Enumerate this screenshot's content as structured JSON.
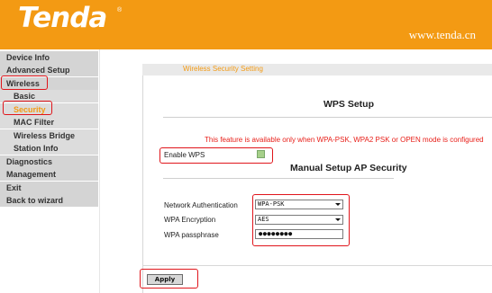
{
  "header": {
    "brand": "Tenda",
    "trademark": "®",
    "url": "www.tenda.cn",
    "background_color": "#f39a13"
  },
  "sidebar": {
    "items": [
      {
        "label": "Device Info",
        "level": "top",
        "active": false
      },
      {
        "label": "Advanced Setup",
        "level": "top",
        "active": false
      },
      {
        "label": "Wireless",
        "level": "top",
        "active": false,
        "highlighted": true
      },
      {
        "label": "Basic",
        "level": "sub",
        "active": false
      },
      {
        "label": "Security",
        "level": "sub",
        "active": true,
        "highlighted": true
      },
      {
        "label": "MAC Filter",
        "level": "sub",
        "active": false
      },
      {
        "label": "Wireless Bridge",
        "level": "sub",
        "active": false
      },
      {
        "label": "Station Info",
        "level": "sub",
        "active": false
      },
      {
        "label": "Diagnostics",
        "level": "top",
        "active": false
      },
      {
        "label": "Management",
        "level": "top",
        "active": false
      },
      {
        "label": "Exit",
        "level": "top",
        "active": false
      },
      {
        "label": "Back to wizard",
        "level": "top",
        "active": false
      }
    ],
    "active_color": "#f39a13"
  },
  "main": {
    "section_title": "Wireless Security Setting",
    "wps_heading": "WPS Setup",
    "notice": "This feature is available only when WPA-PSK, WPA2 PSK or OPEN mode is configured",
    "enable_wps_label": "Enable WPS",
    "enable_wps_checked": false,
    "manual_heading": "Manual Setup AP Security",
    "network_auth_label": "Network Authentication",
    "network_auth_value": "WPA-PSK",
    "encryption_label": "WPA Encryption",
    "encryption_value": "AES",
    "passphrase_label": "WPA passphrase",
    "passphrase_value": "●●●●●●●●",
    "apply_label": "Apply",
    "notice_color": "#e8201a"
  },
  "annotations": {
    "highlight_color": "#e0151b"
  }
}
